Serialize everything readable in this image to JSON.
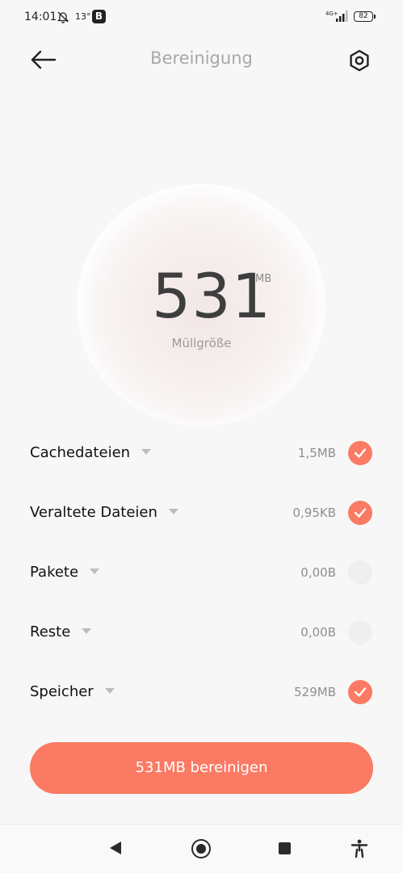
{
  "status_bar": {
    "time": "14:01",
    "temperature": "13°",
    "app_badge": "B",
    "network": "4G+",
    "battery": "82"
  },
  "header": {
    "title": "Bereinigung",
    "back_icon": "arrow-left-icon",
    "settings_icon": "hexagon-settings-icon"
  },
  "summary": {
    "size": "531",
    "unit": "MB",
    "label": "Müllgröße"
  },
  "items": [
    {
      "label": "Cachedateien",
      "size": "1,5MB",
      "checked": true
    },
    {
      "label": "Veraltete Dateien",
      "size": "0,95KB",
      "checked": true
    },
    {
      "label": "Pakete",
      "size": "0,00B",
      "checked": false
    },
    {
      "label": "Reste",
      "size": "0,00B",
      "checked": false
    },
    {
      "label": "Speicher",
      "size": "529MB",
      "checked": true
    }
  ],
  "action": {
    "label": "531MB bereinigen"
  },
  "colors": {
    "accent": "#fa7a63",
    "title": "#a8a8a8",
    "background": "#f7f7f7"
  }
}
